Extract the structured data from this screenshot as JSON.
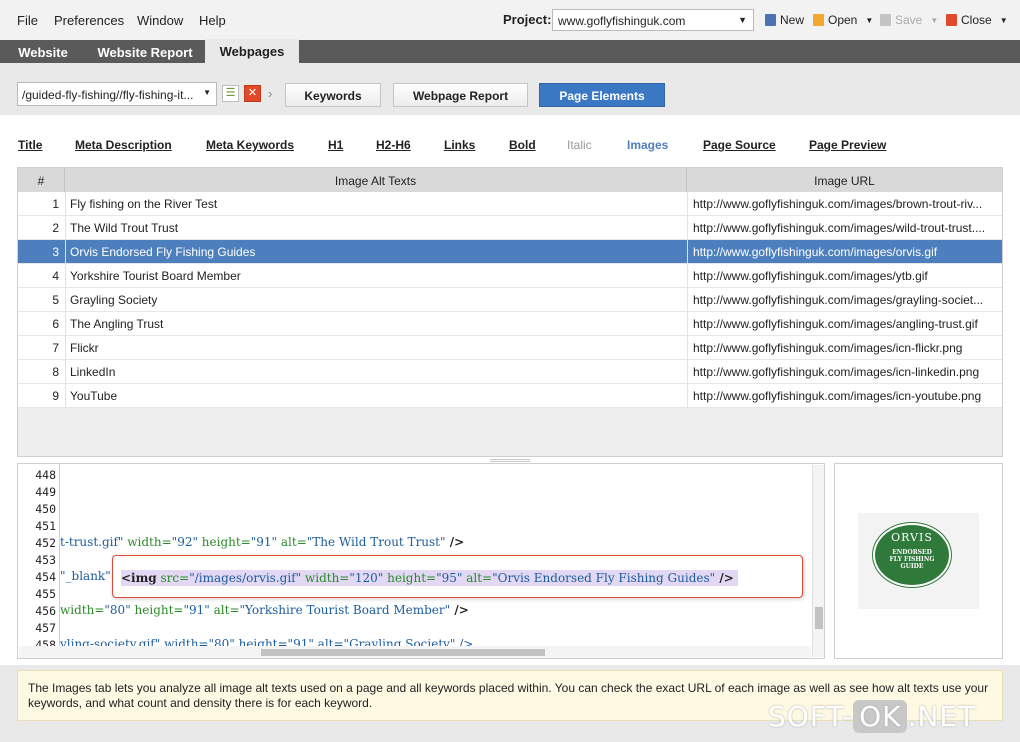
{
  "menu": {
    "file": "File",
    "preferences": "Preferences",
    "window": "Window",
    "help": "Help"
  },
  "project": {
    "label": "Project:",
    "value": "www.goflyfishinguk.com"
  },
  "toolbar": {
    "new": "New",
    "open": "Open",
    "save": "Save",
    "close": "Close"
  },
  "tabs": [
    "Website",
    "Website Report",
    "Webpages"
  ],
  "url_select": "/guided-fly-fishing//fly-fishing-it...",
  "actions": {
    "keywords": "Keywords",
    "webpage_report": "Webpage Report",
    "page_elements": "Page Elements"
  },
  "element_tabs": [
    "Title",
    "Meta Description",
    "Meta Keywords",
    "H1",
    "H2-H6",
    "Links",
    "Bold",
    "Italic",
    "Images",
    "Page Source",
    "Page Preview"
  ],
  "table": {
    "headers": [
      "#",
      "Image Alt Texts",
      "Image URL"
    ],
    "rows": [
      {
        "num": "1",
        "alt": "Fly fishing on the River Test",
        "url": "http://www.goflyfishinguk.com/images/brown-trout-riv..."
      },
      {
        "num": "2",
        "alt": "The Wild Trout Trust",
        "url": "http://www.goflyfishinguk.com/images/wild-trout-trust...."
      },
      {
        "num": "3",
        "alt": "Orvis Endorsed Fly Fishing Guides",
        "url": "http://www.goflyfishinguk.com/images/orvis.gif"
      },
      {
        "num": "4",
        "alt": "Yorkshire Tourist Board Member",
        "url": "http://www.goflyfishinguk.com/images/ytb.gif"
      },
      {
        "num": "5",
        "alt": "Grayling Society",
        "url": "http://www.goflyfishinguk.com/images/grayling-societ..."
      },
      {
        "num": "6",
        "alt": "The Angling Trust",
        "url": "http://www.goflyfishinguk.com/images/angling-trust.gif"
      },
      {
        "num": "7",
        "alt": "Flickr",
        "url": "http://www.goflyfishinguk.com/images/icn-flickr.png"
      },
      {
        "num": "8",
        "alt": "LinkedIn",
        "url": "http://www.goflyfishinguk.com/images/icn-linkedin.png"
      },
      {
        "num": "9",
        "alt": "YouTube",
        "url": "http://www.goflyfishinguk.com/images/icn-youtube.png"
      }
    ]
  },
  "code": {
    "line_numbers": [
      "448",
      "449",
      "450",
      "451",
      "452",
      "453",
      "454",
      "455",
      "456",
      "457",
      "458"
    ],
    "line452": {
      "a": "t-trust.gif\"",
      "b": " width=",
      "c": "\"92\"",
      "d": " height=",
      "e": "\"91\"",
      "f": " alt=",
      "g": "\"The Wild Trout Trust\"",
      "h": " />"
    },
    "line454_prefix": "\"_blank\">",
    "line456": {
      "a": "width=",
      "b": "\"80\"",
      "c": " height=",
      "d": "\"91\"",
      "e": " alt=",
      "f": "\"Yorkshire Tourist Board Member\"",
      "g": " />"
    },
    "line458": "yling-society.gif\" width=\"80\" height=\"91\" alt=\"Grayling Society\" />",
    "highlight": {
      "tag": "<img",
      "s1": " src=",
      "v1": "\"/images/orvis.gif\"",
      "s2": " width=",
      "v2": "\"120\"",
      "s3": " height=",
      "v3": "\"95\"",
      "s4": " alt=",
      "v4": "\"Orvis Endorsed Fly Fishing Guides\"",
      "end": " />"
    }
  },
  "preview_logo": {
    "brand": "ORVIS",
    "line1": "ENDORSED",
    "line2": "FLY FISHING",
    "line3": "GUIDE"
  },
  "info_text": "The Images tab lets you analyze all image alt texts used on a page and all keywords placed within. You can check the exact URL of each image as well as see how alt texts use your keywords, and what count and density there is for each keyword.",
  "watermark": {
    "a": "SOFT-",
    "b": "OK",
    "c": ".NET"
  },
  "colors": {
    "accent": "#3a78c3",
    "selected_row": "#4d7fbf",
    "tab_bar": "#5a5a5a",
    "callout_border": "#e04a3a",
    "info_bg": "#fdf9e3"
  }
}
